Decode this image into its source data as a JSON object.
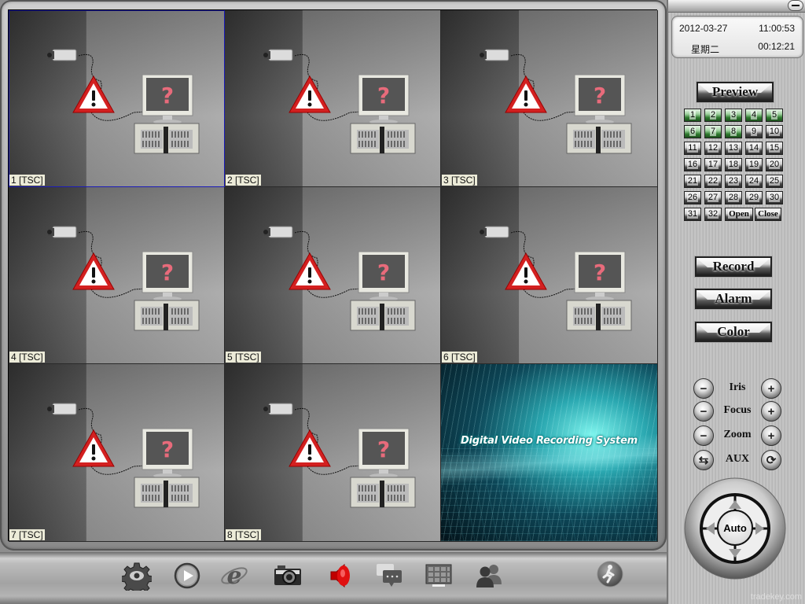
{
  "video": {
    "channels": [
      {
        "label": "1 [TSC]",
        "state": "no-signal",
        "selected": true
      },
      {
        "label": "2 [TSC]",
        "state": "no-signal",
        "selected": false
      },
      {
        "label": "3 [TSC]",
        "state": "no-signal",
        "selected": false
      },
      {
        "label": "4 [TSC]",
        "state": "no-signal",
        "selected": false
      },
      {
        "label": "5 [TSC]",
        "state": "no-signal",
        "selected": false
      },
      {
        "label": "6 [TSC]",
        "state": "no-signal",
        "selected": false
      },
      {
        "label": "7 [TSC]",
        "state": "no-signal",
        "selected": false
      },
      {
        "label": "8 [TSC]",
        "state": "no-signal",
        "selected": false
      }
    ],
    "splash_title": "Digital Video Recording System",
    "selection_color": "#1a1ab8"
  },
  "toolbar": {
    "items": [
      {
        "name": "settings",
        "icon": "gear-eye-icon"
      },
      {
        "name": "playback",
        "icon": "play-icon"
      },
      {
        "name": "web-browser",
        "icon": "internet-explorer-icon"
      },
      {
        "name": "snapshot",
        "icon": "camera-icon"
      },
      {
        "name": "audio",
        "icon": "speaker-icon",
        "active_color": "#d00000"
      },
      {
        "name": "messages",
        "icon": "chat-icon"
      },
      {
        "name": "layout",
        "icon": "grid-layout-icon"
      },
      {
        "name": "users",
        "icon": "users-icon"
      },
      {
        "name": "exit",
        "icon": "running-man-icon"
      }
    ]
  },
  "panel": {
    "clock": {
      "date": "2012-03-27",
      "time": "11:00:53",
      "weekday": "星期二",
      "elapsed": "00:12:21"
    },
    "preview_label": "Preview",
    "channel_buttons": [
      {
        "label": "1",
        "on": true
      },
      {
        "label": "2",
        "on": true
      },
      {
        "label": "3",
        "on": true
      },
      {
        "label": "4",
        "on": true
      },
      {
        "label": "5",
        "on": true
      },
      {
        "label": "6",
        "on": true
      },
      {
        "label": "7",
        "on": true
      },
      {
        "label": "8",
        "on": true
      },
      {
        "label": "9",
        "on": false
      },
      {
        "label": "10",
        "on": false
      },
      {
        "label": "11",
        "on": false
      },
      {
        "label": "12",
        "on": false
      },
      {
        "label": "13",
        "on": false
      },
      {
        "label": "14",
        "on": false
      },
      {
        "label": "15",
        "on": false
      },
      {
        "label": "16",
        "on": false
      },
      {
        "label": "17",
        "on": false
      },
      {
        "label": "18",
        "on": false
      },
      {
        "label": "19",
        "on": false
      },
      {
        "label": "20",
        "on": false
      },
      {
        "label": "21",
        "on": false
      },
      {
        "label": "22",
        "on": false
      },
      {
        "label": "23",
        "on": false
      },
      {
        "label": "24",
        "on": false
      },
      {
        "label": "25",
        "on": false
      },
      {
        "label": "26",
        "on": false
      },
      {
        "label": "27",
        "on": false
      },
      {
        "label": "28",
        "on": false
      },
      {
        "label": "29",
        "on": false
      },
      {
        "label": "30",
        "on": false
      },
      {
        "label": "31",
        "on": false
      },
      {
        "label": "32",
        "on": false
      }
    ],
    "open_label": "Open",
    "close_label": "Close",
    "record_label": "Record",
    "alarm_label": "Alarm",
    "color_label": "Color",
    "ptz": [
      {
        "label": "Iris",
        "left": "−",
        "right": "+"
      },
      {
        "label": "Focus",
        "left": "−",
        "right": "+"
      },
      {
        "label": "Zoom",
        "left": "−",
        "right": "+"
      },
      {
        "label": "AUX",
        "left": "⇆",
        "right": "⟳"
      }
    ],
    "auto_label": "Auto",
    "active_green": "#2f7a2f"
  },
  "watermark": "tradekey.com"
}
